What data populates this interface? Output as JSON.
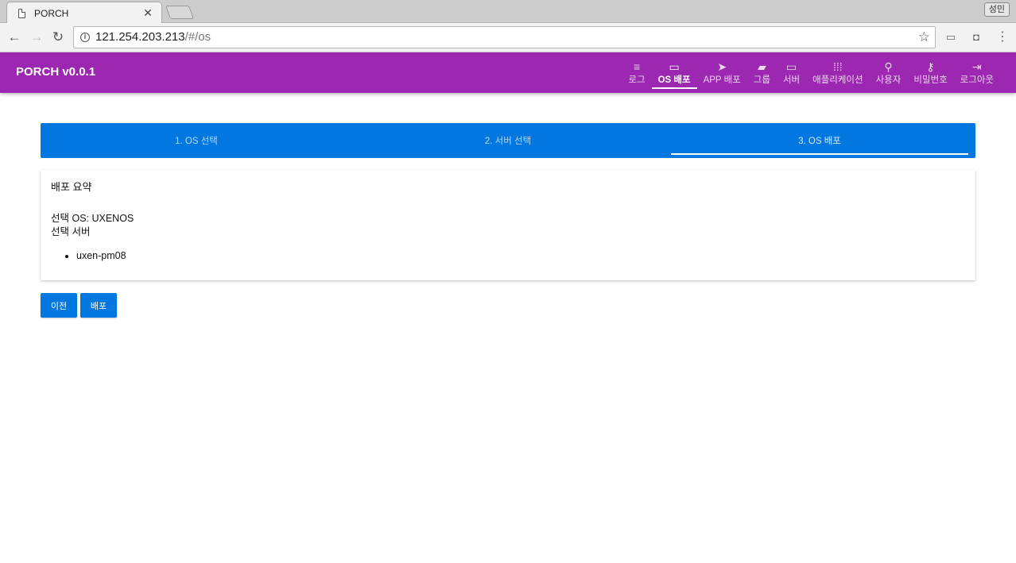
{
  "browser": {
    "tab_title": "PORCH",
    "tab_close": "✕",
    "user_badge": "성민",
    "url_host": "121.254.203.213",
    "url_path": "/#/os"
  },
  "app": {
    "brand": "PORCH v0.0.1",
    "accent_color": "#9c27b0",
    "primary_color": "#0277e0",
    "nav": [
      {
        "label": "로그",
        "icon": "list-icon",
        "glyph": "≡",
        "active": false
      },
      {
        "label": "OS 배포",
        "icon": "cast-icon",
        "glyph": "▭",
        "active": true
      },
      {
        "label": "APP 배포",
        "icon": "send-icon",
        "glyph": "➤",
        "active": false
      },
      {
        "label": "그룹",
        "icon": "folder-add-icon",
        "glyph": "▰",
        "active": false
      },
      {
        "label": "서버",
        "icon": "laptop-icon",
        "glyph": "▭",
        "active": false
      },
      {
        "label": "애플리케이션",
        "icon": "apps-grid-icon",
        "glyph": "⁞⁞⁞",
        "active": false
      },
      {
        "label": "사용자",
        "icon": "person-icon",
        "glyph": "⚲",
        "active": false
      },
      {
        "label": "비밀번호",
        "icon": "key-icon",
        "glyph": "⚷",
        "active": false
      },
      {
        "label": "로그아웃",
        "icon": "exit-icon",
        "glyph": "⇥",
        "active": false
      }
    ]
  },
  "stepper": {
    "steps": [
      {
        "label": "1. OS 선택",
        "active": false
      },
      {
        "label": "2. 서버 선택",
        "active": false
      },
      {
        "label": "3. OS 배포",
        "active": true
      }
    ]
  },
  "summary": {
    "title": "배포 요약",
    "selected_os": "선택 OS: UXENOS",
    "selected_servers_label": "선택 서버",
    "servers": [
      "uxen-pm08"
    ]
  },
  "actions": {
    "prev_label": "이전",
    "deploy_label": "배포"
  }
}
